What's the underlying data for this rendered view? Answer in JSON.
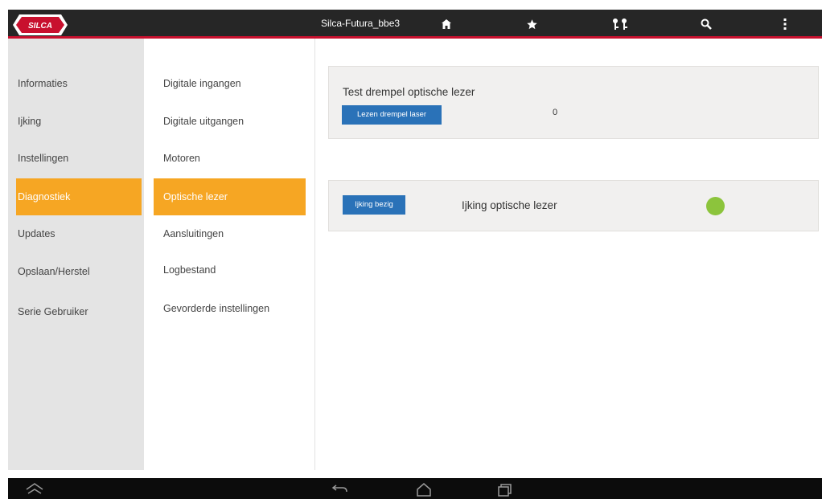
{
  "topbar": {
    "device_name": "Silca-Futura_bbe3",
    "icons": [
      "home-icon",
      "star-icon",
      "keys-icon",
      "search-icon",
      "more-vert-icon"
    ],
    "logo_text": "SILCA",
    "accent_color": "#c8102e"
  },
  "sidebar": {
    "items": [
      {
        "label": "Informaties",
        "active": false
      },
      {
        "label": "Ijking",
        "active": false
      },
      {
        "label": "Instellingen",
        "active": false
      },
      {
        "label": "Diagnostiek",
        "active": true
      },
      {
        "label": "Updates",
        "active": false
      },
      {
        "label": "Opslaan/Herstel",
        "active": false
      },
      {
        "label": "Serie Gebruiker",
        "active": false
      }
    ],
    "active_color": "#f6a623"
  },
  "submenu": {
    "items": [
      {
        "label": "Digitale ingangen",
        "active": false
      },
      {
        "label": "Digitale uitgangen",
        "active": false
      },
      {
        "label": "Motoren",
        "active": false
      },
      {
        "label": "Optische lezer",
        "active": true
      },
      {
        "label": "Aansluitingen",
        "active": false
      },
      {
        "label": "Logbestand",
        "active": false
      },
      {
        "label": "Gevorderde instellingen",
        "active": false
      }
    ]
  },
  "main": {
    "threshold_panel": {
      "title": "Test drempel optische lezer",
      "button_label": "Lezen drempel laser",
      "value": "0"
    },
    "calibration_panel": {
      "button_label": "Ijking bezig",
      "label": "Ijking optische lezer",
      "status_color": "#8cc43c"
    }
  },
  "system_bar": {
    "icons": [
      "expand-icon",
      "back-icon",
      "home-outline-icon",
      "recent-apps-icon"
    ]
  }
}
